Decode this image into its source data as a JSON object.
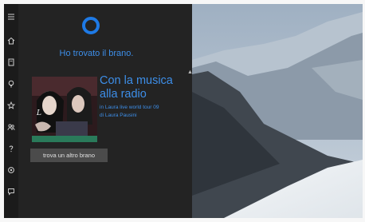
{
  "cortana": {
    "message": "Ho trovato il brano."
  },
  "song": {
    "title": "Con la musica alla radio",
    "album_line": "in Laura live world tour 09",
    "artist_line": "di Laura Pausini"
  },
  "actions": {
    "find_another_label": "trova un altro brano"
  },
  "sidebar": {
    "icons": [
      "menu-icon",
      "home-icon",
      "notebook-icon",
      "lightbulb-icon",
      "star-icon",
      "people-icon",
      "help-icon",
      "settings-icon",
      "feedback-icon"
    ]
  },
  "colors": {
    "accent": "#1e7ae6",
    "text_accent": "#3d8ee8",
    "panel_bg": "#232323",
    "button_bg": "#4b4b4b"
  }
}
